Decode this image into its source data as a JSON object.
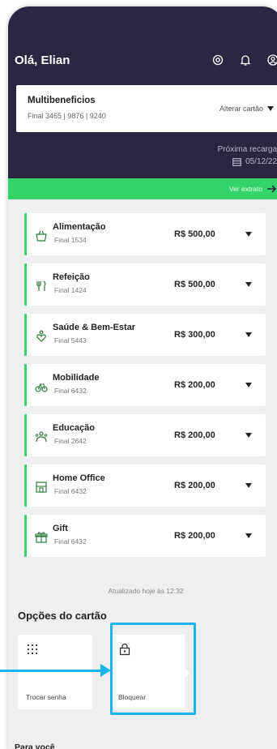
{
  "header": {
    "greeting": "Olá, Elian",
    "icons": [
      "eye-icon",
      "bell-icon",
      "user-icon"
    ]
  },
  "card": {
    "name": "Multibeneficios",
    "finals": "Final 3465 | 9876 | 9240",
    "change_label": "Alterar cartão"
  },
  "recharge": {
    "label": "Próxima recarga",
    "date": "05/12/22"
  },
  "extract_link": "Ver extrato",
  "benefits": [
    {
      "title": "Alimentação",
      "final": "Final 1534",
      "value": "R$ 500,00",
      "icon": "basket-icon"
    },
    {
      "title": "Refeição",
      "final": "Final 1424",
      "value": "R$ 500,00",
      "icon": "cutlery-icon"
    },
    {
      "title": "Saúde & Bem-Estar",
      "final": "Final 5443",
      "value": "R$ 300,00",
      "icon": "health-icon"
    },
    {
      "title": "Mobilidade",
      "final": "Final 6432",
      "value": "R$ 200,00",
      "icon": "bicycle-icon"
    },
    {
      "title": "Educação",
      "final": "Final 2642",
      "value": "R$ 200,00",
      "icon": "education-icon"
    },
    {
      "title": "Home Office",
      "final": "Final 6432",
      "value": "R$ 200,00",
      "icon": "building-icon"
    },
    {
      "title": "Gift",
      "final": "Final 6432",
      "value": "R$ 200,00",
      "icon": "gift-icon"
    }
  ],
  "updated_text": "Atualizado hoje às 12:32",
  "options": {
    "title": "Opções do cartão",
    "items": [
      {
        "label": "Trocar senha",
        "icon": "keypad-icon"
      },
      {
        "label": "Bloquear",
        "icon": "lock-icon"
      }
    ]
  },
  "for_you_title": "Para você",
  "colors": {
    "header_bg": "#2b2443",
    "accent_green": "#34d36b",
    "highlight_blue": "#19b5ec"
  }
}
